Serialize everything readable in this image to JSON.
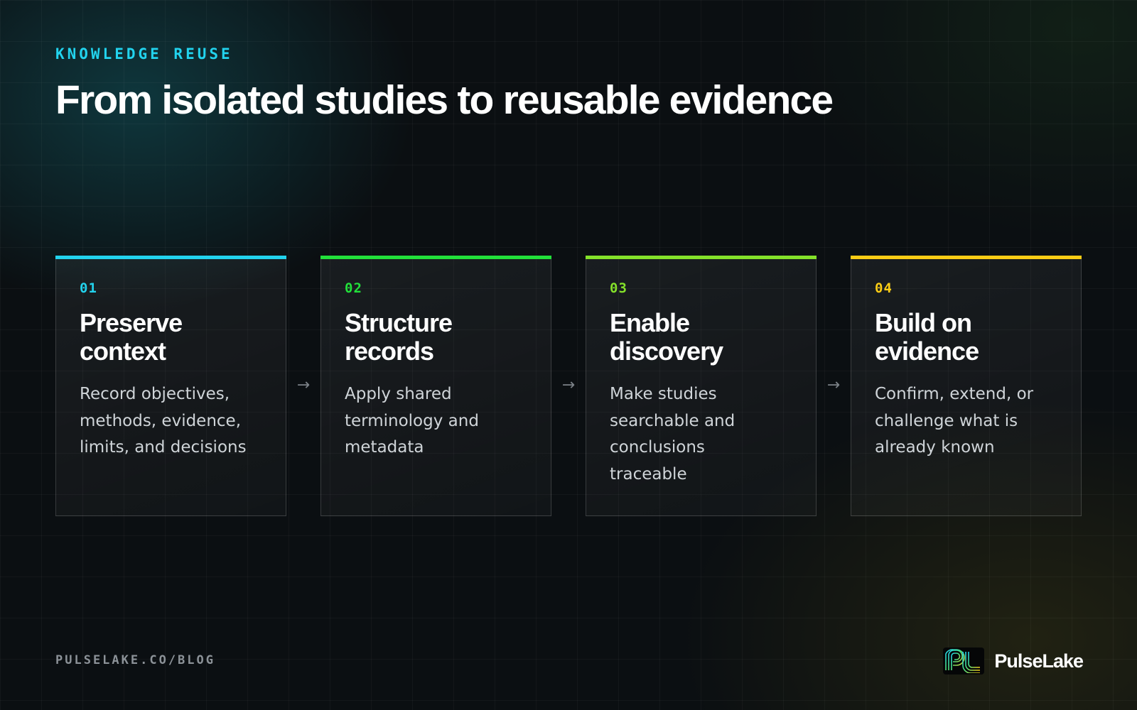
{
  "eyebrow": "KNOWLEDGE REUSE",
  "title": "From isolated studies to reusable evidence",
  "steps": [
    {
      "number": "01",
      "heading_line1": "Preserve",
      "heading_line2": "context",
      "desc_lines": [
        "Record objectives,",
        "methods, evidence,",
        "limits, and decisions"
      ],
      "accent_color": "#22d3ee"
    },
    {
      "number": "02",
      "heading_line1": "Structure",
      "heading_line2": "records",
      "desc_lines": [
        "Apply shared",
        "terminology and",
        "metadata"
      ],
      "accent_color": "#22e03a"
    },
    {
      "number": "03",
      "heading_line1": "Enable",
      "heading_line2": "discovery",
      "desc_lines": [
        "Make studies",
        "searchable and",
        "conclusions",
        "traceable"
      ],
      "accent_color": "#84e12a"
    },
    {
      "number": "04",
      "heading_line1": "Build on",
      "heading_line2": "evidence",
      "desc_lines": [
        "Confirm, extend, or",
        "challenge what is",
        "already known"
      ],
      "accent_color": "#facc15"
    }
  ],
  "arrow_glyph": "→",
  "footer": {
    "url": "PULSELAKE.CO/BLOG",
    "brand_name": "PulseLake",
    "logo_icon": "pulselake-logo-icon"
  }
}
